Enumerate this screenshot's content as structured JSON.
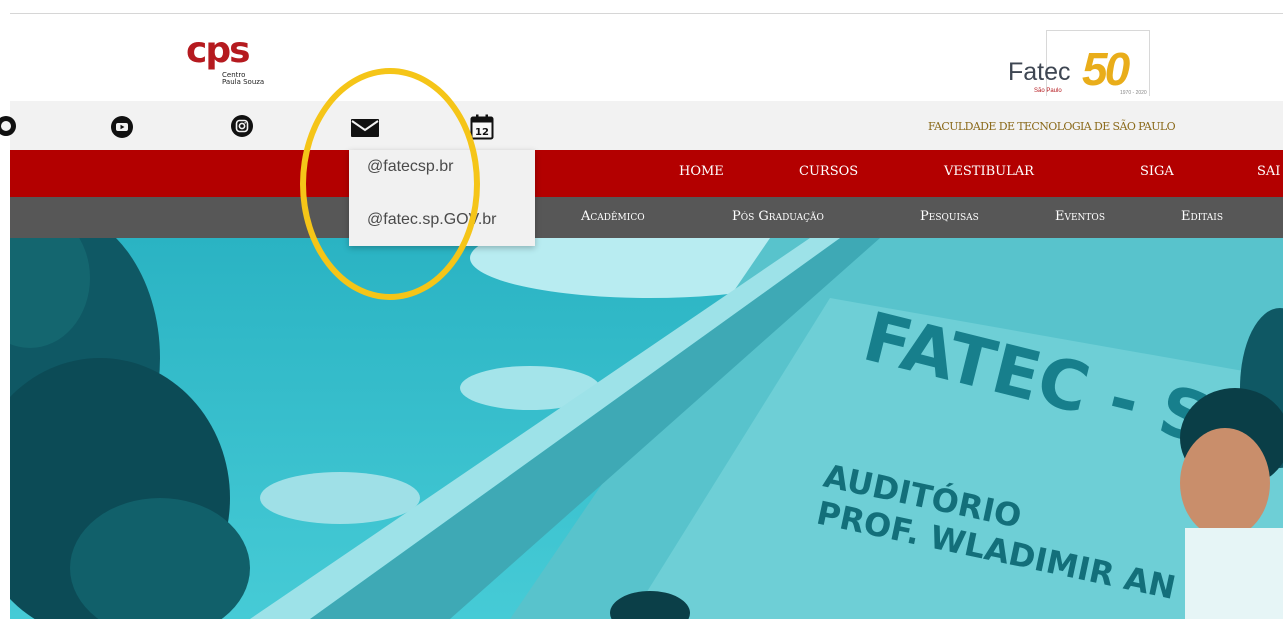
{
  "logos": {
    "cps": {
      "letters": "cps",
      "sub_line1": "Centro",
      "sub_line2": "Paula Souza"
    },
    "fatec": {
      "word": "Fatec",
      "city": "São Paulo",
      "number": "50",
      "years": "1970 - 2020"
    }
  },
  "social": {
    "icons": [
      "globe-icon",
      "youtube-icon",
      "instagram-icon",
      "mail-icon",
      "calendar-icon"
    ],
    "calendar_day": "12",
    "tagline": "FACULDADE DE TECNOLOGIA DE SÃO PAULO"
  },
  "nav": {
    "items": [
      "HOME",
      "CURSOS",
      "VESTIBULAR",
      "SIGA",
      "SAI"
    ]
  },
  "subnav": {
    "items": [
      "Acadêmico",
      "Pós Graduação",
      "Pesquisas",
      "Eventos",
      "Editais"
    ]
  },
  "mail_dropdown": {
    "items": [
      "@fatecsp.br",
      "@fatec.sp.GOV.br"
    ]
  },
  "hero": {
    "sign_line1": "FATEC - SP",
    "sign_line2": "AUDITÓRIO",
    "sign_line3": "PROF. WLADIMIR AN"
  },
  "colors": {
    "brand_red": "#b30000",
    "subnav_grey": "#575757",
    "tagline_gold": "#8b6a1b",
    "hero_cyan": "#2fc0cd",
    "highlight_yellow": "#f5c518"
  }
}
